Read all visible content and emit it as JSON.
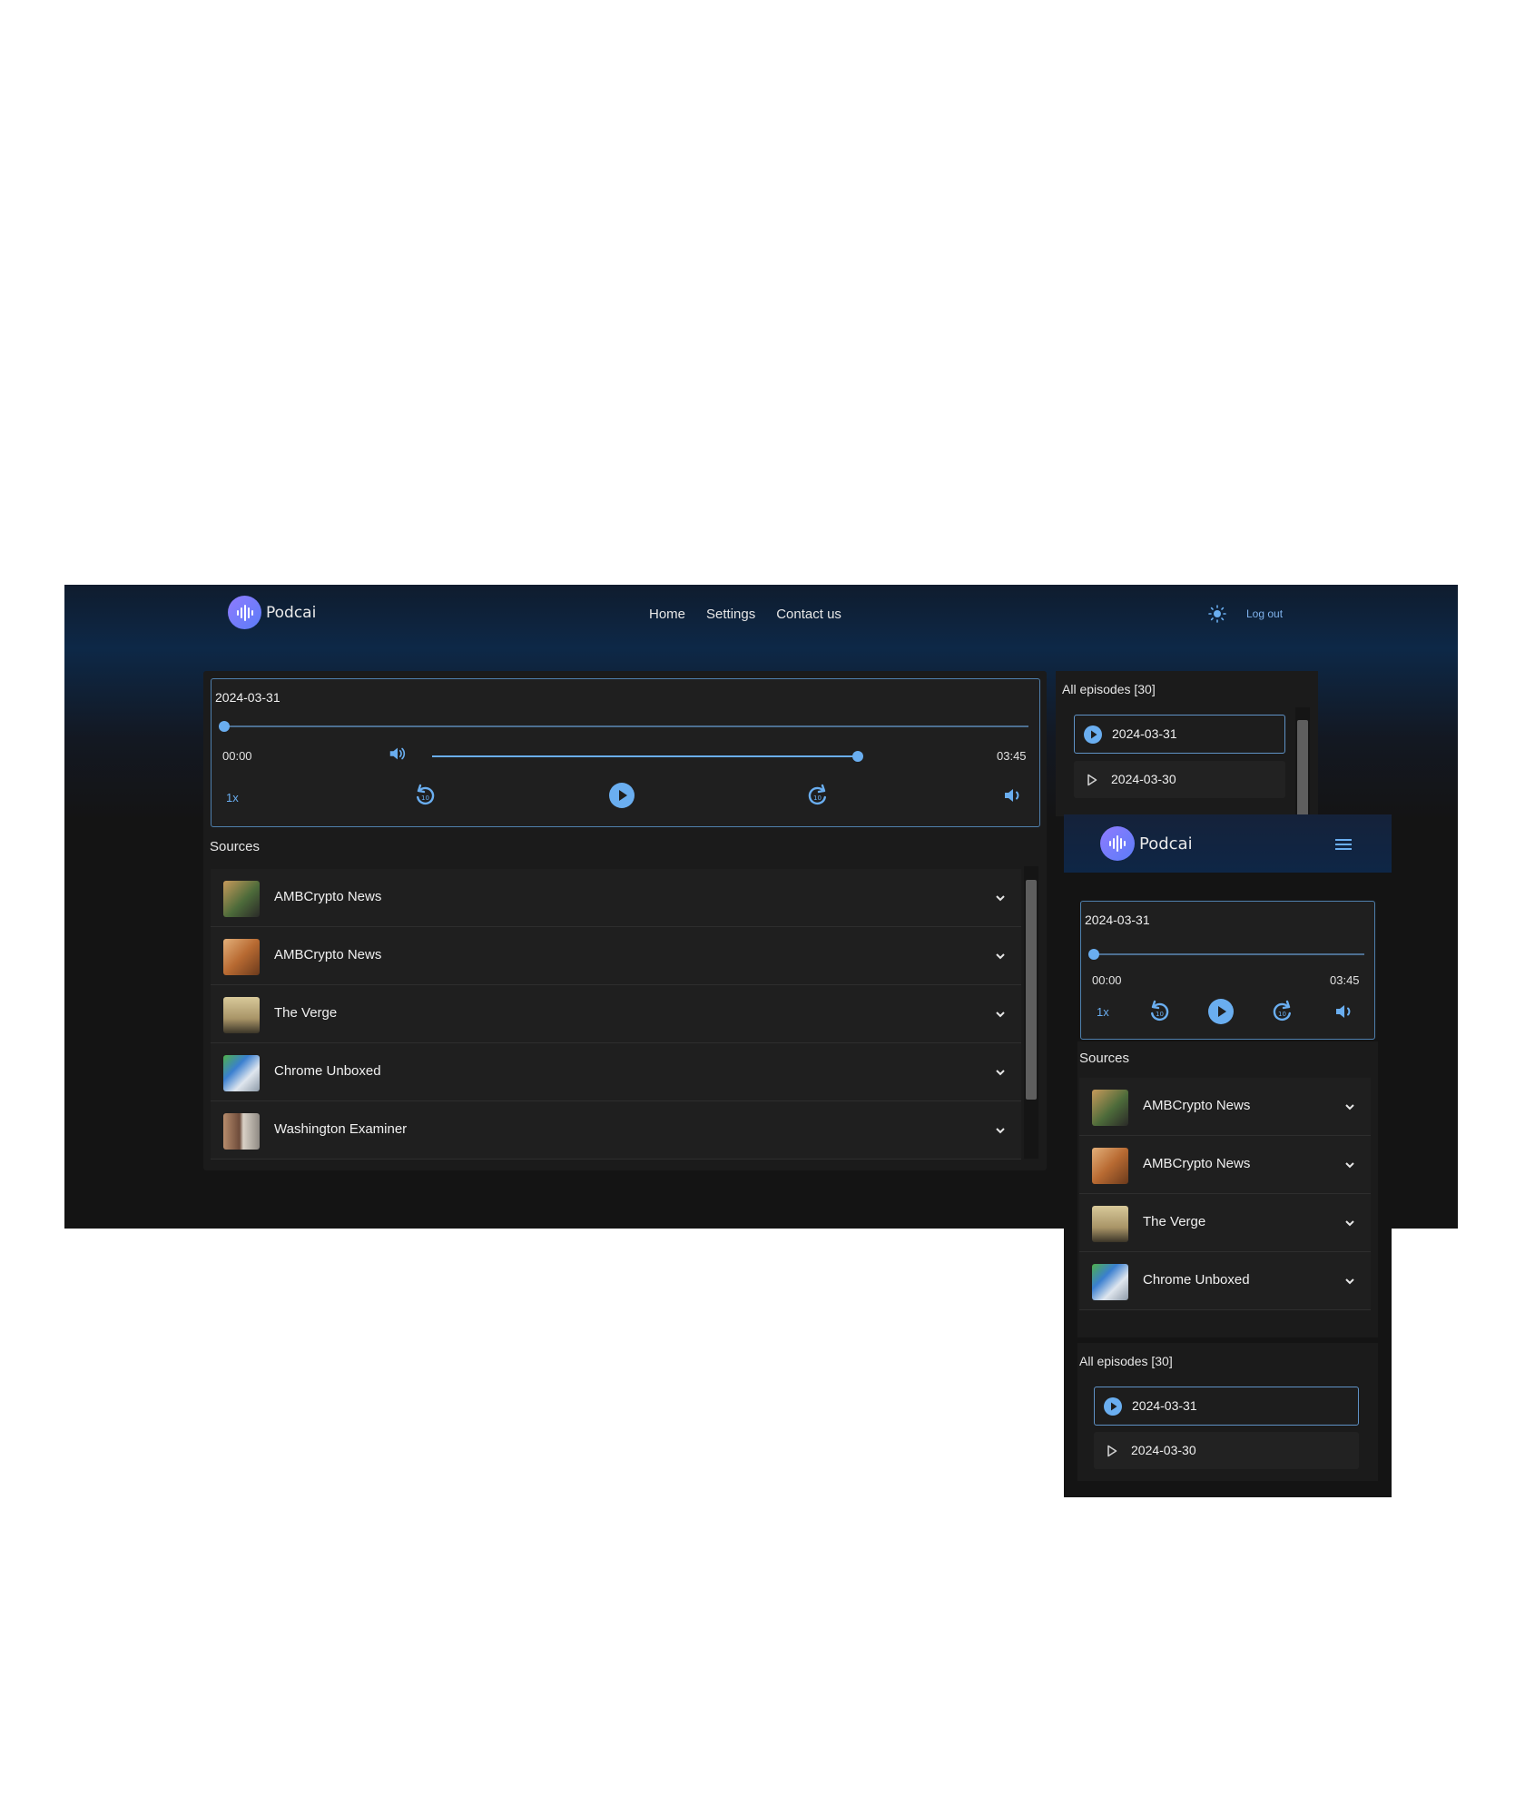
{
  "app": {
    "name": "Podcai"
  },
  "nav": {
    "home": "Home",
    "settings": "Settings",
    "contact": "Contact us",
    "logout": "Log out"
  },
  "player": {
    "date": "2024-03-31",
    "current_time": "00:00",
    "duration": "03:45",
    "speed": "1x",
    "progress": 0.0,
    "volume": 1.0
  },
  "sources": {
    "label": "Sources",
    "items": [
      {
        "name": "AMBCrypto News"
      },
      {
        "name": "AMBCrypto News"
      },
      {
        "name": "The Verge"
      },
      {
        "name": "Chrome Unboxed"
      },
      {
        "name": "Washington Examiner"
      }
    ]
  },
  "episodes": {
    "label": "All episodes [30]",
    "items": [
      {
        "date": "2024-03-31",
        "active": true
      },
      {
        "date": "2024-03-30",
        "active": false
      }
    ]
  },
  "colors": {
    "accent": "#6aaef0",
    "brand": "#7b7dfa",
    "surface": "#1b1b1b",
    "background": "#141414"
  }
}
